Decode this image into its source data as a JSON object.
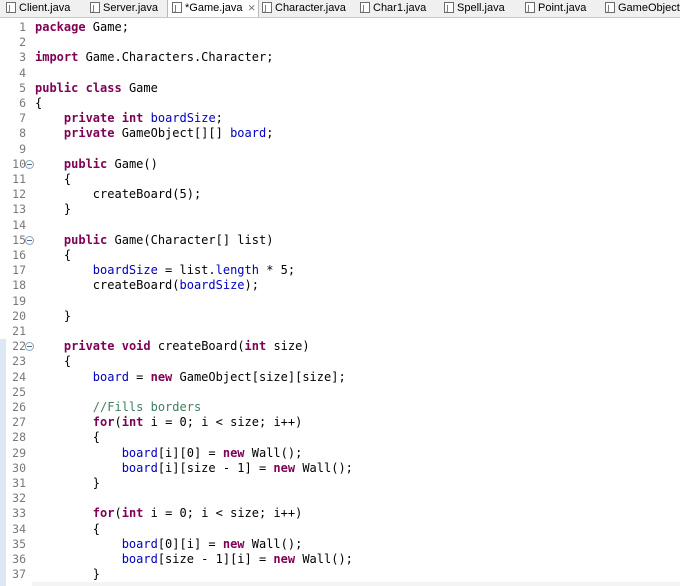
{
  "tabs": [
    {
      "label": "Client.java",
      "active": false,
      "closable": false
    },
    {
      "label": "Server.java",
      "active": false,
      "closable": false
    },
    {
      "label": "*Game.java",
      "active": true,
      "closable": true
    },
    {
      "label": "Character.java",
      "active": false,
      "closable": false
    },
    {
      "label": "Char1.java",
      "active": false,
      "closable": false
    },
    {
      "label": "Spell.java",
      "active": false,
      "closable": false
    },
    {
      "label": "Point.java",
      "active": false,
      "closable": false
    },
    {
      "label": "GameObject.ja",
      "active": false,
      "closable": false
    }
  ],
  "close_glyph": "⨯",
  "colors": {
    "keyword": "#7f0055",
    "field": "#0000c0",
    "comment": "#3f7f5f",
    "line_number": "#787878"
  },
  "lines": [
    {
      "n": "1",
      "fold": false,
      "segs": [
        [
          "kw",
          "package"
        ],
        [
          "",
          "Game;"
        ]
      ]
    },
    {
      "n": "2",
      "fold": false,
      "segs": []
    },
    {
      "n": "3",
      "fold": false,
      "segs": [
        [
          "kw",
          "import"
        ],
        [
          "",
          "Game.Characters.Character;"
        ]
      ]
    },
    {
      "n": "4",
      "fold": false,
      "segs": []
    },
    {
      "n": "5",
      "fold": false,
      "segs": [
        [
          "kw",
          "public"
        ],
        [
          "",
          ""
        ],
        [
          "kw",
          "class"
        ],
        [
          "",
          "Game"
        ]
      ]
    },
    {
      "n": "6",
      "fold": false,
      "segs": [
        [
          "",
          "{"
        ]
      ]
    },
    {
      "n": "7",
      "fold": false,
      "segs": [
        [
          "",
          "    "
        ],
        [
          "kw",
          "private"
        ],
        [
          "",
          ""
        ],
        [
          "kw",
          "int"
        ],
        [
          "",
          ""
        ],
        [
          "fld",
          "boardSize"
        ],
        [
          "",
          ";"
        ]
      ]
    },
    {
      "n": "8",
      "fold": false,
      "segs": [
        [
          "",
          "    "
        ],
        [
          "kw",
          "private"
        ],
        [
          "",
          "GameObject[][]"
        ],
        [
          "fld",
          "board"
        ],
        [
          "",
          ";"
        ]
      ]
    },
    {
      "n": "9",
      "fold": false,
      "segs": []
    },
    {
      "n": "10",
      "fold": true,
      "segs": [
        [
          "",
          "    "
        ],
        [
          "kw",
          "public"
        ],
        [
          "",
          "Game()"
        ]
      ]
    },
    {
      "n": "11",
      "fold": false,
      "segs": [
        [
          "",
          "    {"
        ]
      ]
    },
    {
      "n": "12",
      "fold": false,
      "segs": [
        [
          "",
          "        createBoard(5);"
        ]
      ]
    },
    {
      "n": "13",
      "fold": false,
      "segs": [
        [
          "",
          "    }"
        ]
      ]
    },
    {
      "n": "14",
      "fold": false,
      "segs": []
    },
    {
      "n": "15",
      "fold": true,
      "segs": [
        [
          "",
          "    "
        ],
        [
          "kw",
          "public"
        ],
        [
          "",
          "Game(Character[] list)"
        ]
      ]
    },
    {
      "n": "16",
      "fold": false,
      "segs": [
        [
          "",
          "    {"
        ]
      ]
    },
    {
      "n": "17",
      "fold": false,
      "segs": [
        [
          "",
          "        "
        ],
        [
          "fld",
          "boardSize"
        ],
        [
          "",
          "= list."
        ],
        [
          "fld",
          "length"
        ],
        [
          "",
          "* 5;"
        ]
      ]
    },
    {
      "n": "18",
      "fold": false,
      "segs": [
        [
          "",
          "        createBoard("
        ],
        [
          "fld",
          "boardSize"
        ],
        [
          "",
          ");"
        ]
      ]
    },
    {
      "n": "19",
      "fold": false,
      "segs": []
    },
    {
      "n": "20",
      "fold": false,
      "segs": [
        [
          "",
          "    }"
        ]
      ]
    },
    {
      "n": "21",
      "fold": false,
      "segs": []
    },
    {
      "n": "22",
      "fold": true,
      "segs": [
        [
          "",
          "    "
        ],
        [
          "kw",
          "private"
        ],
        [
          "",
          ""
        ],
        [
          "kw",
          "void"
        ],
        [
          "",
          "createBoard("
        ],
        [
          "kw",
          "int"
        ],
        [
          "",
          "size)"
        ]
      ]
    },
    {
      "n": "23",
      "fold": false,
      "segs": [
        [
          "",
          "    {"
        ]
      ]
    },
    {
      "n": "24",
      "fold": false,
      "segs": [
        [
          "",
          "        "
        ],
        [
          "fld",
          "board"
        ],
        [
          "",
          "="
        ],
        [
          "kw",
          "new"
        ],
        [
          "",
          "GameObject[size][size];"
        ]
      ]
    },
    {
      "n": "25",
      "fold": false,
      "segs": []
    },
    {
      "n": "26",
      "fold": false,
      "segs": [
        [
          "",
          "        "
        ],
        [
          "cmt",
          "//Fills borders"
        ]
      ]
    },
    {
      "n": "27",
      "fold": false,
      "segs": [
        [
          "",
          "        "
        ],
        [
          "kw",
          "for"
        ],
        [
          "",
          "("
        ],
        [
          "kw",
          "int"
        ],
        [
          "",
          "i = 0; i < size; i++)"
        ]
      ]
    },
    {
      "n": "28",
      "fold": false,
      "segs": [
        [
          "",
          "        {"
        ]
      ]
    },
    {
      "n": "29",
      "fold": false,
      "segs": [
        [
          "",
          "            "
        ],
        [
          "fld",
          "board"
        ],
        [
          "",
          "[i][0] ="
        ],
        [
          "kw",
          "new"
        ],
        [
          "",
          "Wall();"
        ]
      ]
    },
    {
      "n": "30",
      "fold": false,
      "segs": [
        [
          "",
          "            "
        ],
        [
          "fld",
          "board"
        ],
        [
          "",
          "[i][size - 1] ="
        ],
        [
          "kw",
          "new"
        ],
        [
          "",
          "Wall();"
        ]
      ]
    },
    {
      "n": "31",
      "fold": false,
      "segs": [
        [
          "",
          "        }"
        ]
      ]
    },
    {
      "n": "32",
      "fold": false,
      "segs": []
    },
    {
      "n": "33",
      "fold": false,
      "segs": [
        [
          "",
          "        "
        ],
        [
          "kw",
          "for"
        ],
        [
          "",
          "("
        ],
        [
          "kw",
          "int"
        ],
        [
          "",
          "i = 0; i < size; i++)"
        ]
      ]
    },
    {
      "n": "34",
      "fold": false,
      "segs": [
        [
          "",
          "        {"
        ]
      ]
    },
    {
      "n": "35",
      "fold": false,
      "segs": [
        [
          "",
          "            "
        ],
        [
          "fld",
          "board"
        ],
        [
          "",
          "[0][i] ="
        ],
        [
          "kw",
          "new"
        ],
        [
          "",
          "Wall();"
        ]
      ]
    },
    {
      "n": "36",
      "fold": false,
      "segs": [
        [
          "",
          "            "
        ],
        [
          "fld",
          "board"
        ],
        [
          "",
          "[size - 1][i] ="
        ],
        [
          "kw",
          "new"
        ],
        [
          "",
          "Wall();"
        ]
      ]
    },
    {
      "n": "37",
      "fold": false,
      "segs": [
        [
          "",
          "        }"
        ]
      ]
    }
  ]
}
